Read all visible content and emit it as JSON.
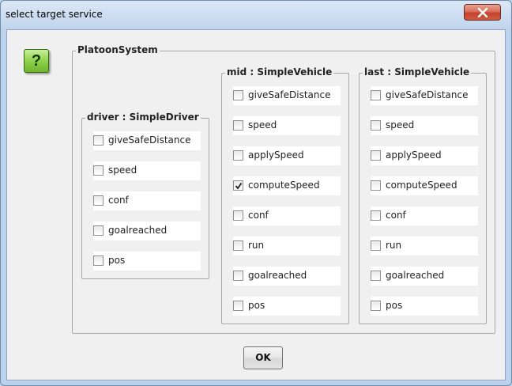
{
  "window": {
    "title": "select target service"
  },
  "icons": {
    "question": "?"
  },
  "system": {
    "title": "PlatoonSystem"
  },
  "driver": {
    "title": "driver : SimpleDriver",
    "items": [
      {
        "label": "giveSafeDistance",
        "checked": false
      },
      {
        "label": "speed",
        "checked": false
      },
      {
        "label": "conf",
        "checked": false
      },
      {
        "label": "goalreached",
        "checked": false
      },
      {
        "label": "pos",
        "checked": false
      }
    ]
  },
  "mid": {
    "title": "mid : SimpleVehicle",
    "items": [
      {
        "label": "giveSafeDistance",
        "checked": false
      },
      {
        "label": "speed",
        "checked": false
      },
      {
        "label": "applySpeed",
        "checked": false
      },
      {
        "label": "computeSpeed",
        "checked": true
      },
      {
        "label": "conf",
        "checked": false
      },
      {
        "label": "run",
        "checked": false
      },
      {
        "label": "goalreached",
        "checked": false
      },
      {
        "label": "pos",
        "checked": false
      }
    ]
  },
  "last": {
    "title": "last : SimpleVehicle",
    "items": [
      {
        "label": "giveSafeDistance",
        "checked": false
      },
      {
        "label": "speed",
        "checked": false
      },
      {
        "label": "applySpeed",
        "checked": false
      },
      {
        "label": "computeSpeed",
        "checked": false
      },
      {
        "label": "conf",
        "checked": false
      },
      {
        "label": "run",
        "checked": false
      },
      {
        "label": "goalreached",
        "checked": false
      },
      {
        "label": "pos",
        "checked": false
      }
    ]
  },
  "buttons": {
    "ok": "OK"
  }
}
